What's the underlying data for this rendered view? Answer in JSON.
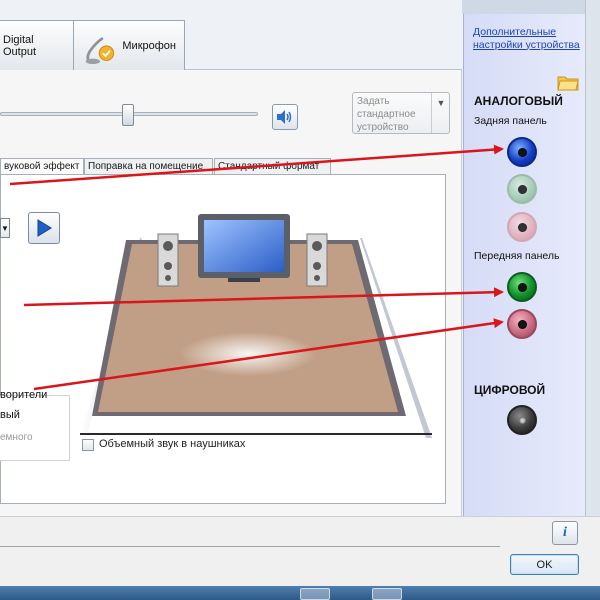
{
  "tabs": [
    {
      "label": "Digital Output"
    },
    {
      "label": "Микрофон"
    }
  ],
  "toolbar": {
    "default_device_label": "Задать стандартное устройство",
    "dropdown_glyph": "▼"
  },
  "subtabs": [
    {
      "label": "вуковой эффект"
    },
    {
      "label": "Поправка на помещение"
    },
    {
      "label": "Стандартный формат"
    }
  ],
  "playback": {
    "combo_glyph": "▼"
  },
  "options": {
    "item1": "ворители",
    "item2": "вый",
    "item3": "емного"
  },
  "headphones_checkbox_label": "Объемный звук в наушниках",
  "right_panel": {
    "advanced_link": "Дополнительные настройки устройства",
    "analog_heading": "АНАЛОГОВЫЙ",
    "rear_panel_label": "Задняя панель",
    "front_panel_label": "Передняя панель",
    "digital_heading": "ЦИФРОВОЙ"
  },
  "buttons": {
    "ok": "OK",
    "info_glyph": "i"
  },
  "colors": {
    "accent_blue": "#1440c8",
    "arrow_red": "#d9161b",
    "link_blue": "#1a46b4"
  },
  "icons": {
    "tab_digital": "digital-output-icon",
    "tab_mic": "microphone-icon",
    "speaker": "speaker-volume-icon",
    "play": "play-icon",
    "folder": "folder-icon",
    "info": "info-icon"
  }
}
